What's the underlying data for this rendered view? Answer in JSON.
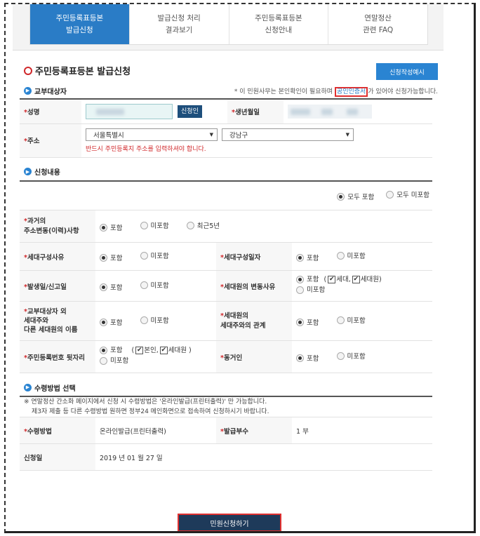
{
  "tabs": [
    {
      "label": "주민등록표등본\n발급신청",
      "active": true
    },
    {
      "label": "발급신청 처리\n결과보기",
      "active": false
    },
    {
      "label": "주민등록표등본\n신청안내",
      "active": false
    },
    {
      "label": "연말정산\n관련 FAQ",
      "active": false
    }
  ],
  "page": {
    "title": "주민등록표등본 발급신청",
    "example_button": "신청작성예시"
  },
  "section1": {
    "title": "교부대상자",
    "notice_pre": "* 이 민원사무는 본인확인이 필요하며",
    "notice_cert": "공인인증서",
    "notice_post": "가 있어야 신청가능합니다.",
    "name_label": "성명",
    "name_button": "신청인",
    "dob_label": "생년월일",
    "addr_label": "주소",
    "addr_city": "서울특별시",
    "addr_district": "강남구",
    "addr_warning": "반드시 주민등록지 주소를 입력하셔야 합니다."
  },
  "section2": {
    "title": "신청내용",
    "all_include": "모두 포함",
    "all_exclude": "모두 미포함",
    "include": "포함",
    "exclude": "미포함",
    "recent5": "최근5년",
    "row1_label": "과거의\n주소변동(이력)사항",
    "row2_label_a": "세대구성사유",
    "row2_label_b": "세대구성일자",
    "row3_label_a": "발생일/신고일",
    "row3_label_b": "세대원의 변동사유",
    "row3_chk1": "세대,",
    "row3_chk2": "세대원)",
    "row4_label_a": "교부대상자 외\n세대주와\n다른 세대원의 이름",
    "row4_label_b": "세대원의\n세대주와의 관계",
    "row5_label_a": "주민등록번호 뒷자리",
    "row5_chk_open": "(",
    "row5_chk1": "본인,",
    "row5_chk2": "세대원 )",
    "row5_label_b": "동거인"
  },
  "section3": {
    "title": "수령방법 선택",
    "memo_line1": "※ 연말정산 간소화 페이지에서 신청 시 수령방법은 '온라인발급(프린터출력)' 만 가능합니다.",
    "memo_line2": "제3자 제출 등 다른 수령방법 원하면 정부24 메인화면으로 접속하여 신청하시기 바랍니다.",
    "method_label": "수령방법",
    "method_value": "온라인발급(프린터출력)",
    "copies_label": "발급부수",
    "copies_value": "1 부",
    "date_label": "신청일",
    "date_value": "2019 년 01 월 27 일"
  },
  "submit_label": "민원신청하기",
  "colors": {
    "accent": "#2a7cc6",
    "required": "#d0282b",
    "highlight": "#e03030",
    "submit_bg": "#1e3a5a"
  }
}
